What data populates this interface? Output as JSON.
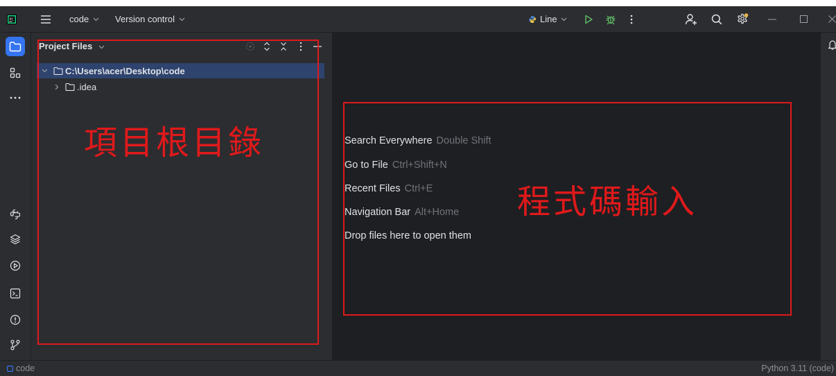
{
  "titlebar": {
    "project_label": "code",
    "vcs_label": "Version control",
    "run_config_label": "Line"
  },
  "project_panel": {
    "title": "Project Files",
    "tree": [
      {
        "label": "C:\\Users\\acer\\Desktop\\code",
        "expanded": true,
        "selected": true
      },
      {
        "label": ".idea",
        "expanded": false,
        "selected": false
      }
    ]
  },
  "editor": {
    "hints": [
      {
        "label": "Search Everywhere",
        "shortcut": "Double Shift"
      },
      {
        "label": "Go to File",
        "shortcut": "Ctrl+Shift+N"
      },
      {
        "label": "Recent Files",
        "shortcut": "Ctrl+E"
      },
      {
        "label": "Navigation Bar",
        "shortcut": "Alt+Home"
      },
      {
        "label": "Drop files here to open them",
        "shortcut": ""
      }
    ]
  },
  "annotations": {
    "project_root": "項目根目錄",
    "code_input": "程式碼輸入"
  },
  "statusbar": {
    "project": "code",
    "interpreter": "Python 3.11 (code)"
  },
  "colors": {
    "accent": "#3574f0",
    "annotation": "#e0191b",
    "run_green": "#5fb865"
  },
  "icons": [
    "app-logo-icon",
    "hamburger-menu-icon",
    "chevron-down-icon",
    "python-icon",
    "run-icon",
    "debug-icon",
    "more-vertical-icon",
    "add-user-icon",
    "search-icon",
    "settings-icon",
    "minimize-icon",
    "maximize-icon",
    "close-icon",
    "folder-icon",
    "structure-icon",
    "more-horizontal-icon",
    "python-console-icon",
    "layers-icon",
    "services-icon",
    "terminal-icon",
    "problems-icon",
    "git-icon",
    "notifications-icon",
    "locate-icon",
    "expand-all-icon",
    "collapse-all-icon",
    "hide-icon"
  ]
}
